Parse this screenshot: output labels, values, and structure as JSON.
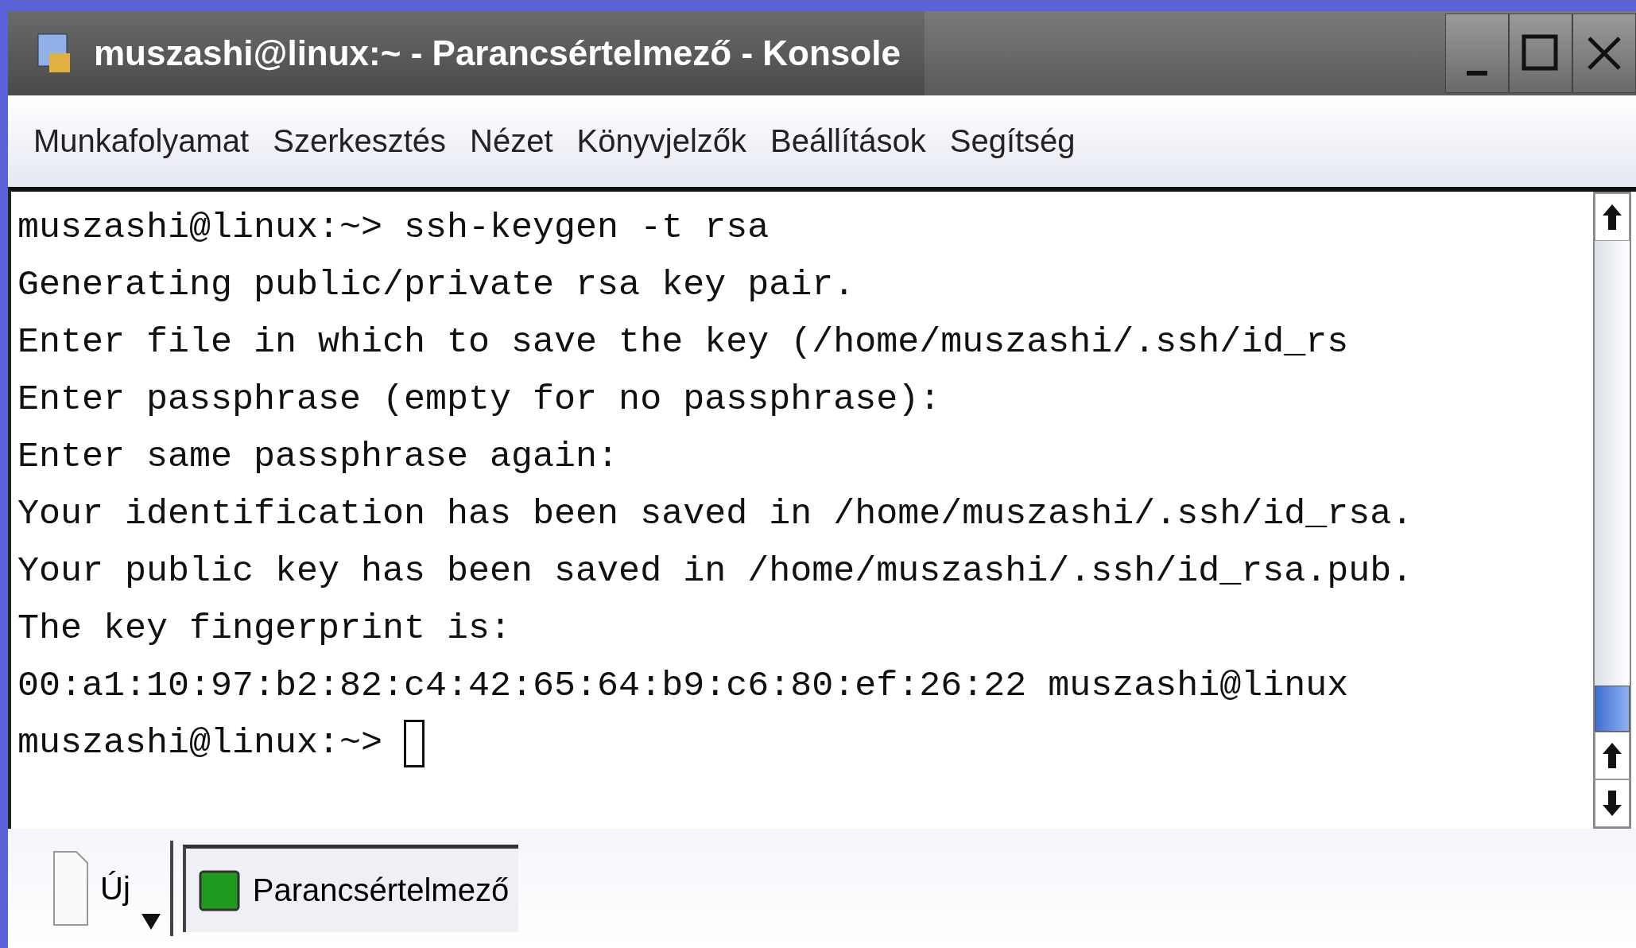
{
  "window": {
    "title": "muszashi@linux:~ - Parancsértelmező - Konsole"
  },
  "menu": [
    "Munkafolyamat",
    "Szerkesztés",
    "Nézet",
    "Könyvjelzők",
    "Beállítások",
    "Segítség"
  ],
  "terminal": {
    "lines": [
      "muszashi@linux:~> ssh-keygen -t rsa",
      "Generating public/private rsa key pair.",
      "Enter file in which to save the key (/home/muszashi/.ssh/id_rs",
      "Enter passphrase (empty for no passphrase):",
      "Enter same passphrase again:",
      "Your identification has been saved in /home/muszashi/.ssh/id_rsa.",
      "Your public key has been saved in /home/muszashi/.ssh/id_rsa.pub.",
      "The key fingerprint is:",
      "00:a1:10:97:b2:82:c4:42:65:64:b9:c6:80:ef:26:22 muszashi@linux"
    ],
    "prompt": "muszashi@linux:~>"
  },
  "new_session": {
    "label": "Új"
  },
  "sessions": [
    {
      "label": "Parancsértelmező",
      "selected": true
    }
  ]
}
